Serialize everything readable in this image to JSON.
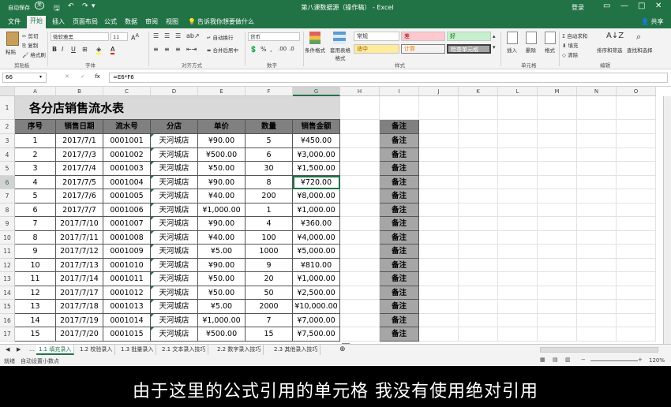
{
  "window": {
    "autosave_label": "自动保存",
    "autosave_state": "关",
    "title": "第八课数据源（操作稿） - Excel",
    "login": "登录"
  },
  "tabs": [
    "文件",
    "开始",
    "插入",
    "页面布局",
    "公式",
    "数据",
    "审阅",
    "视图"
  ],
  "active_tab": "开始",
  "tell_me": "告诉我你想要做什么",
  "share": "共享",
  "ribbon": {
    "clipboard": {
      "paste": "粘贴",
      "cut": "剪切",
      "copy": "复制",
      "format_painter": "格式刷",
      "label": "剪贴板"
    },
    "font": {
      "name": "微软雅黑",
      "size": "11",
      "label": "字体"
    },
    "alignment": {
      "wrap": "自动换行",
      "merge": "合并后居中",
      "label": "对齐方式"
    },
    "number": {
      "format": "货币",
      "label": "数字"
    },
    "styles": {
      "conditional": "条件格式",
      "table": "套用表格格式",
      "normal": "常规",
      "bad": "差",
      "good": "好",
      "neutral": "适中",
      "calc": "计算",
      "check": "检查单元格",
      "label": "样式"
    },
    "cells": {
      "insert": "插入",
      "delete": "删除",
      "format": "格式",
      "label": "单元格"
    },
    "editing": {
      "autosum": "自动求和",
      "fill": "填充",
      "clear": "清除",
      "sort": "排序和筛选",
      "find": "查找和选择",
      "label": "编辑"
    }
  },
  "formula_bar": {
    "name_box": "66",
    "fx": "fx",
    "formula": "=E6*F6"
  },
  "columns": [
    "A",
    "B",
    "C",
    "D",
    "E",
    "F",
    "G",
    "H",
    "I",
    "J",
    "K",
    "L",
    "M",
    "N",
    "O"
  ],
  "selected_column": "G",
  "selected_row": "6",
  "sheet": {
    "title": "各分店销售流水表",
    "headers": [
      "序号",
      "销售日期",
      "流水号",
      "分店",
      "单价",
      "数量",
      "销售金额"
    ],
    "note_header": "备注",
    "rows": [
      [
        "1",
        "2017/7/1",
        "0001001",
        "天河城店",
        "¥90.00",
        "5",
        "¥450.00"
      ],
      [
        "2",
        "2017/7/3",
        "0001002",
        "天河城店",
        "¥500.00",
        "6",
        "¥3,000.00"
      ],
      [
        "3",
        "2017/7/4",
        "0001003",
        "天河城店",
        "¥50.00",
        "30",
        "¥1,500.00"
      ],
      [
        "4",
        "2017/7/5",
        "0001004",
        "天河城店",
        "¥90.00",
        "8",
        "¥720.00"
      ],
      [
        "5",
        "2017/7/6",
        "0001005",
        "天河城店",
        "¥40.00",
        "200",
        "¥8,000.00"
      ],
      [
        "6",
        "2017/7/7",
        "0001006",
        "天河城店",
        "¥1,000.00",
        "1",
        "¥1,000.00"
      ],
      [
        "7",
        "2017/7/10",
        "0001007",
        "天河城店",
        "¥90.00",
        "4",
        "¥360.00"
      ],
      [
        "8",
        "2017/7/11",
        "0001008",
        "天河城店",
        "¥40.00",
        "100",
        "¥4,000.00"
      ],
      [
        "9",
        "2017/7/12",
        "0001009",
        "天河城店",
        "¥5.00",
        "1000",
        "¥5,000.00"
      ],
      [
        "10",
        "2017/7/13",
        "0001010",
        "天河城店",
        "¥90.00",
        "9",
        "¥810.00"
      ],
      [
        "11",
        "2017/7/14",
        "0001011",
        "天河城店",
        "¥50.00",
        "20",
        "¥1,000.00"
      ],
      [
        "12",
        "2017/7/17",
        "0001012",
        "天河城店",
        "¥50.00",
        "50",
        "¥2,500.00"
      ],
      [
        "13",
        "2017/7/18",
        "0001013",
        "天河城店",
        "¥5.00",
        "2000",
        "¥10,000.00"
      ],
      [
        "14",
        "2017/7/19",
        "0001014",
        "天河城店",
        "¥1,000.00",
        "7",
        "¥7,000.00"
      ],
      [
        "15",
        "2017/7/20",
        "0001015",
        "天河城店",
        "¥500.00",
        "15",
        "¥7,500.00"
      ]
    ],
    "note_value": "备注"
  },
  "sheet_tabs": [
    "1.1 填充录入",
    "1.2 校验录入",
    "1.3 批量录入",
    "2.1 文本录入技巧",
    "2.2 数字录入技巧",
    "2.3 其他录入技巧"
  ],
  "active_sheet": "1.1 填充录入",
  "status": {
    "ready": "就绪",
    "autodecimal": "自动设置小数点",
    "zoom": "120%"
  },
  "subtitle": "由于这里的公式引用的单元格 我没有使用绝对引用",
  "colors": {
    "excel_green": "#217346",
    "header_fill": "#808080",
    "note_fill": "#a6a6a6",
    "title_fill": "#d9d9d9"
  }
}
